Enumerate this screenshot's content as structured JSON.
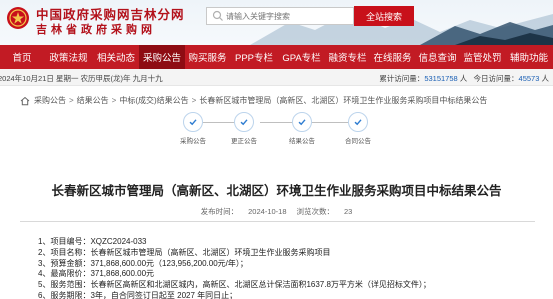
{
  "header": {
    "site_title": "中国政府采购网吉林分网",
    "site_subtitle": "吉林省政府采购网",
    "search": {
      "placeholder": "请输入关键字搜索",
      "button_label": "全站搜索"
    }
  },
  "nav": {
    "items": [
      {
        "label": "首页",
        "active": false
      },
      {
        "label": "政策法规",
        "active": false
      },
      {
        "label": "相关动态",
        "active": false
      },
      {
        "label": "采购公告",
        "active": true
      },
      {
        "label": "购买服务",
        "active": false
      },
      {
        "label": "PPP专栏",
        "active": false
      },
      {
        "label": "GPA专栏",
        "active": false
      },
      {
        "label": "融资专栏",
        "active": false
      },
      {
        "label": "在线服务",
        "active": false
      },
      {
        "label": "信息查询",
        "active": false
      },
      {
        "label": "监管处罚",
        "active": false
      },
      {
        "label": "辅助功能",
        "active": false
      }
    ]
  },
  "datebar": {
    "date": "2024年10月21日 星期一 农历甲辰(龙)年 九月十九",
    "visits_label": "累计访问量：",
    "visits_value": "53151758",
    "visits_unit": "人",
    "today_label": "今日访问量：",
    "today_value": "45573",
    "today_unit": "人"
  },
  "breadcrumb": [
    "采购公告",
    "结果公告",
    "中标(成交)结果公告",
    "长春新区城市管理局（高新区、北湖区）环境卫生作业服务采购项目中标结果公告"
  ],
  "steps": [
    {
      "label": "采购公告"
    },
    {
      "label": "更正公告"
    },
    {
      "label": "结果公告"
    },
    {
      "label": "合同公告"
    }
  ],
  "article": {
    "title": "长春新区城市管理局（高新区、北湖区）环境卫生作业服务采购项目中标结果公告",
    "publish_label": "发布时间：",
    "publish_date": "2024-10-18",
    "views_label": "浏览次数：",
    "views": "23",
    "items": [
      "1、项目编号：XQZC2024-033",
      "2、项目名称：长春新区城市管理局（高新区、北湖区）环境卫生作业服务采购项目",
      "3、预算金额：371,868,600.00元（123,956,200.00元/年）；",
      "4、最高限价：371,868,600.00元",
      "5、服务范围：长春新区高新区和北湖区城内，高新区、北湖区总计保洁面积1637.8万平方米（详见招标文件）；",
      "6、服务期限：3年，自合同签订日起至 2027 年同日止；"
    ]
  },
  "colors": {
    "brand_red": "#c21b24",
    "active_nav": "#8e0c13",
    "step_blue": "#2f7dd1"
  },
  "icons": [
    "emblem-logo",
    "search-icon",
    "home-icon",
    "check-icon"
  ]
}
